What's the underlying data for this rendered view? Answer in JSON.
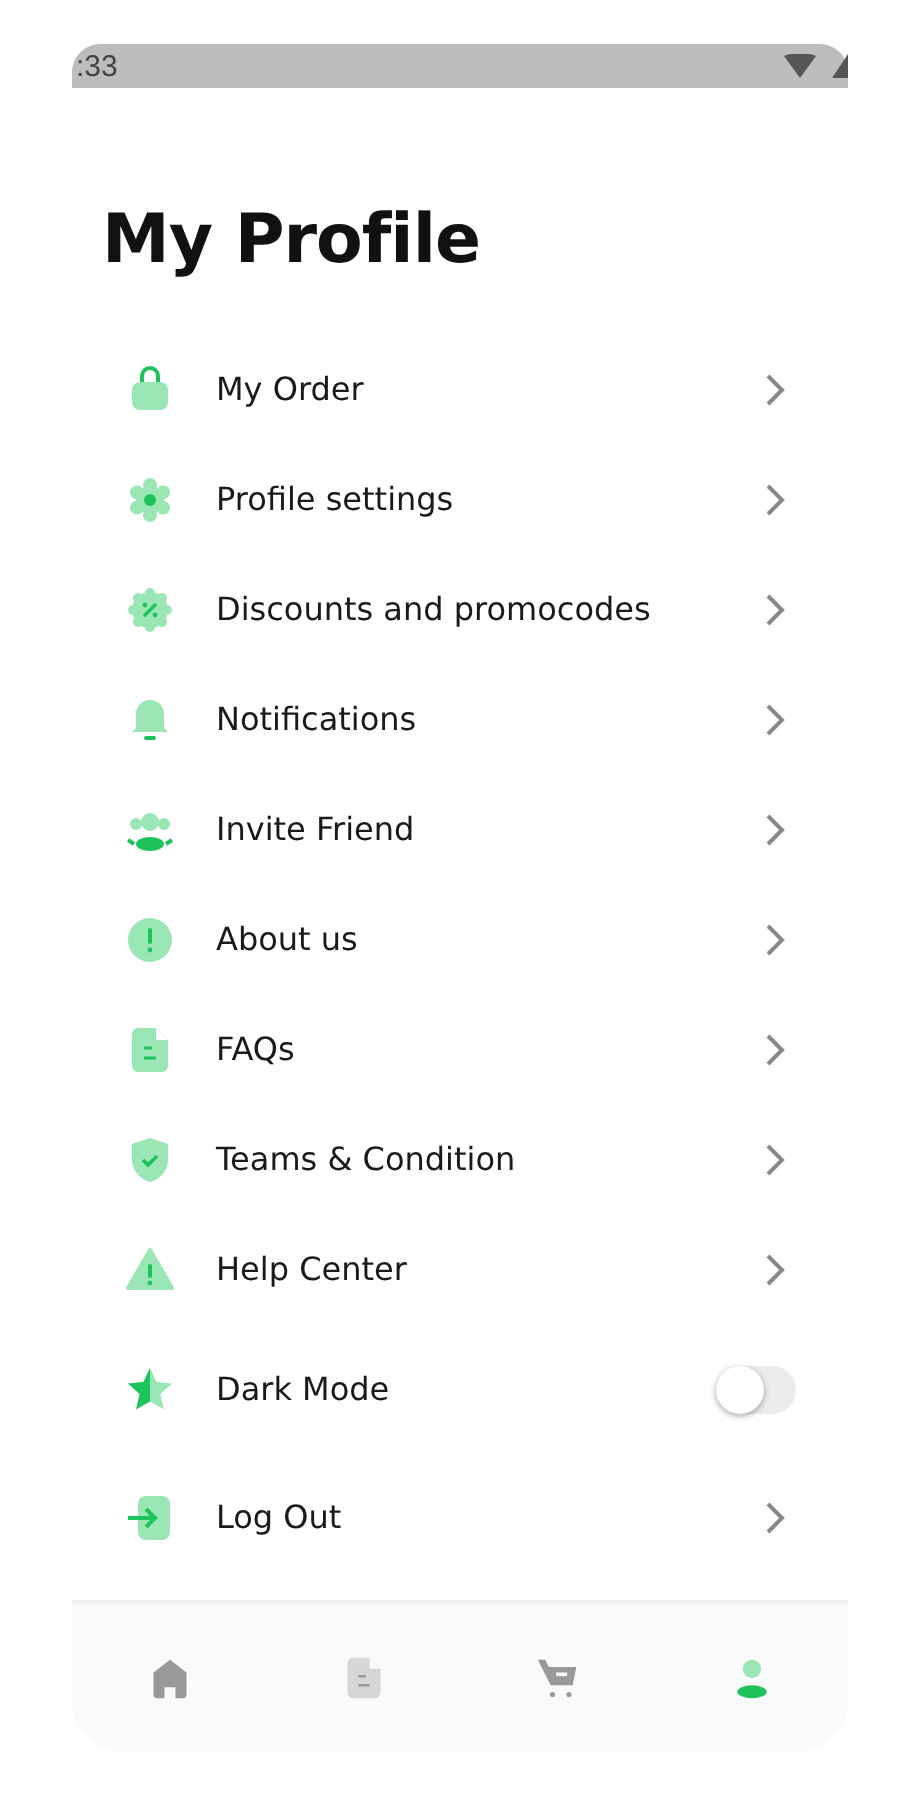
{
  "status_bar": {
    "time": ":33"
  },
  "title": "My Profile",
  "menu": [
    {
      "kind": "link",
      "label": "My Order"
    },
    {
      "kind": "link",
      "label": "Profile settings"
    },
    {
      "kind": "link",
      "label": "Discounts and promocodes"
    },
    {
      "kind": "link",
      "label": "Notifications"
    },
    {
      "kind": "link",
      "label": "Invite Friend"
    },
    {
      "kind": "link",
      "label": "About us"
    },
    {
      "kind": "link",
      "label": "FAQs"
    },
    {
      "kind": "link",
      "label": "Teams & Condition"
    },
    {
      "kind": "link",
      "label": "Help Center"
    },
    {
      "kind": "toggle",
      "label": "Dark Mode",
      "on": false
    },
    {
      "kind": "link",
      "label": "Log Out"
    }
  ],
  "bottom_nav": [
    {
      "selected": false
    },
    {
      "selected": false
    },
    {
      "selected": false
    },
    {
      "selected": true
    }
  ]
}
